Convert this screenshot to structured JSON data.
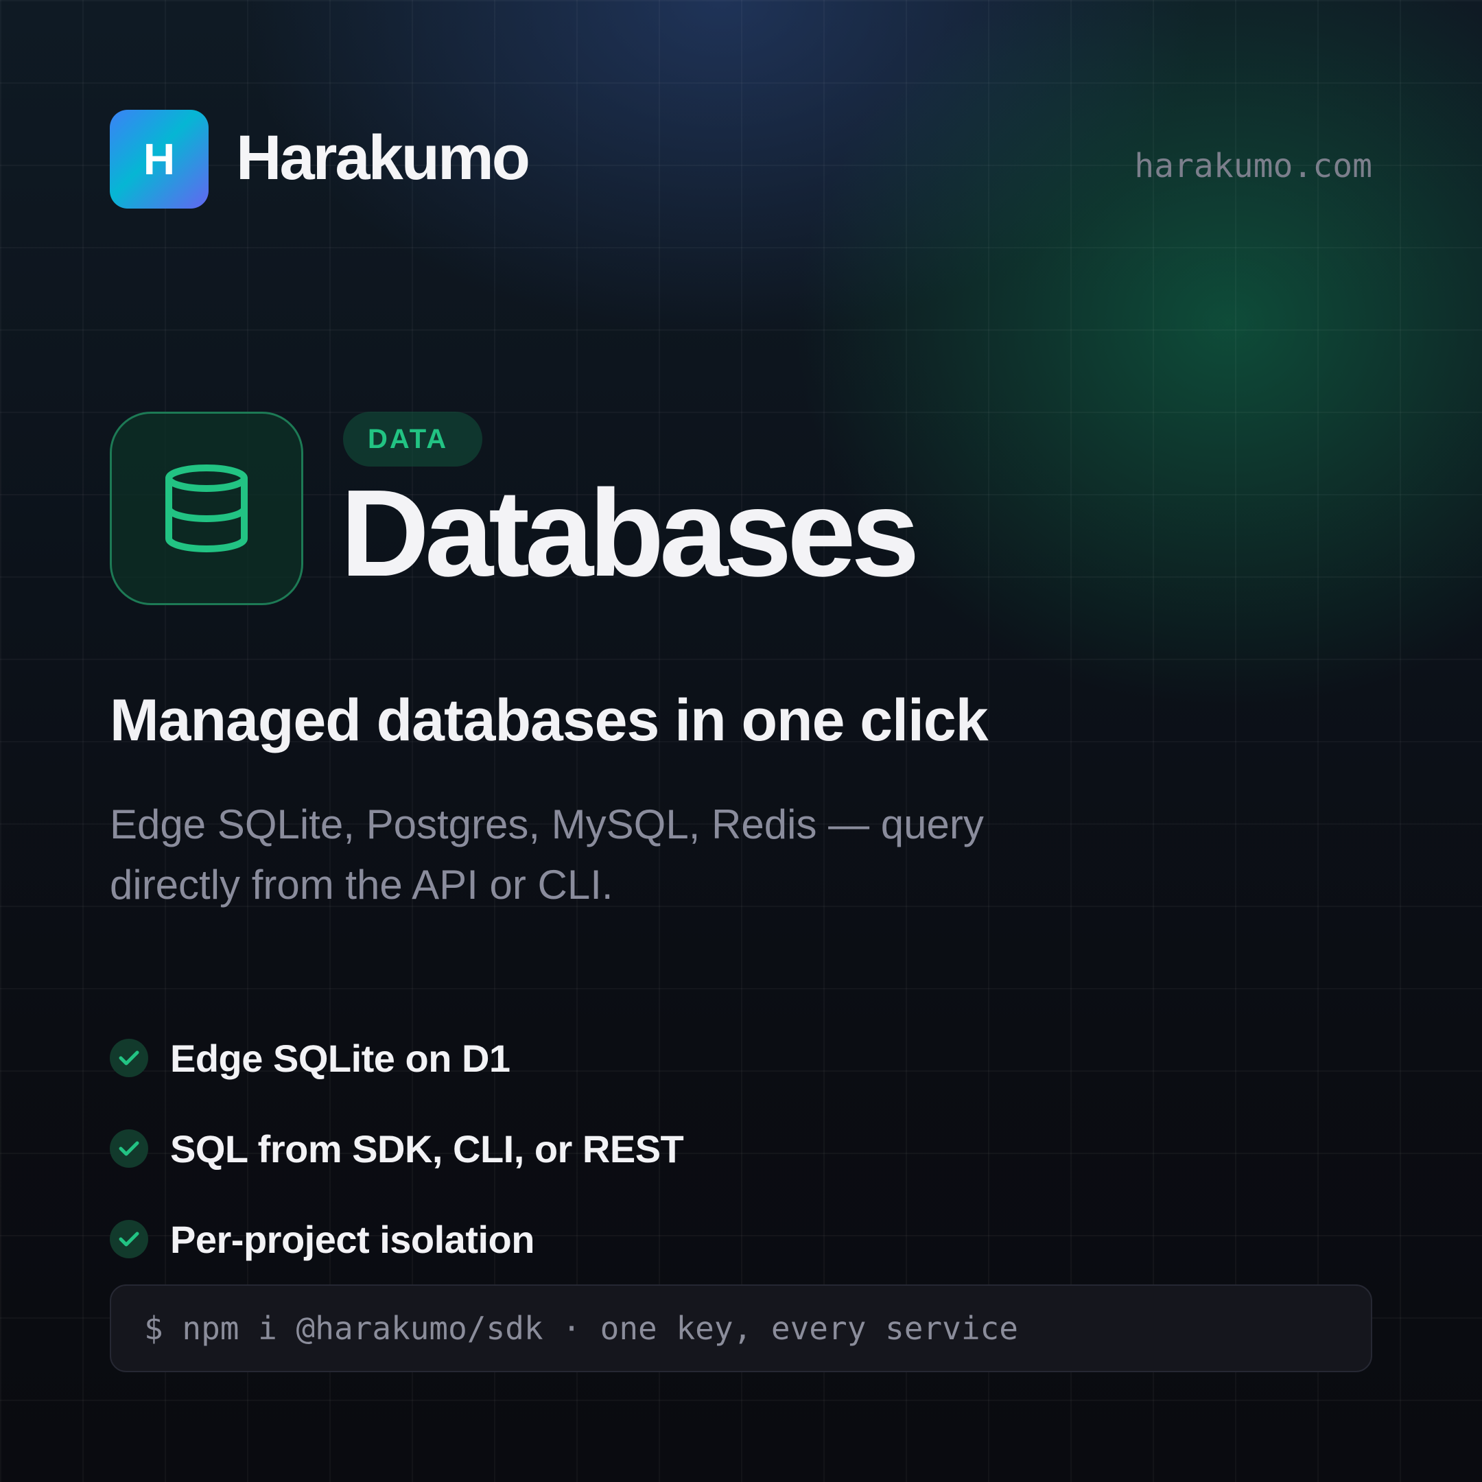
{
  "brand": {
    "logo_letter": "H",
    "name": "Harakumo",
    "url": "harakumo.com"
  },
  "hero": {
    "icon": "database-icon",
    "category": "DATA",
    "title": "Databases"
  },
  "headline": "Managed databases in one click",
  "description": "Edge SQLite, Postgres, MySQL, Redis — query directly from the API or CLI.",
  "features": [
    {
      "label": "Edge SQLite on D1",
      "icon": "check-icon"
    },
    {
      "label": "SQL from SDK, CLI, or REST",
      "icon": "check-icon"
    },
    {
      "label": "Per-project isolation",
      "icon": "check-icon"
    }
  ],
  "install": {
    "command": "$ npm i @harakumo/sdk · one key, every service"
  },
  "colors": {
    "background": "#0b0c11",
    "accent_green": "#22c383",
    "logo_gradient": [
      "#3b82f6",
      "#06b6d4",
      "#6366f1"
    ],
    "muted_text": "#8a8c9c"
  }
}
